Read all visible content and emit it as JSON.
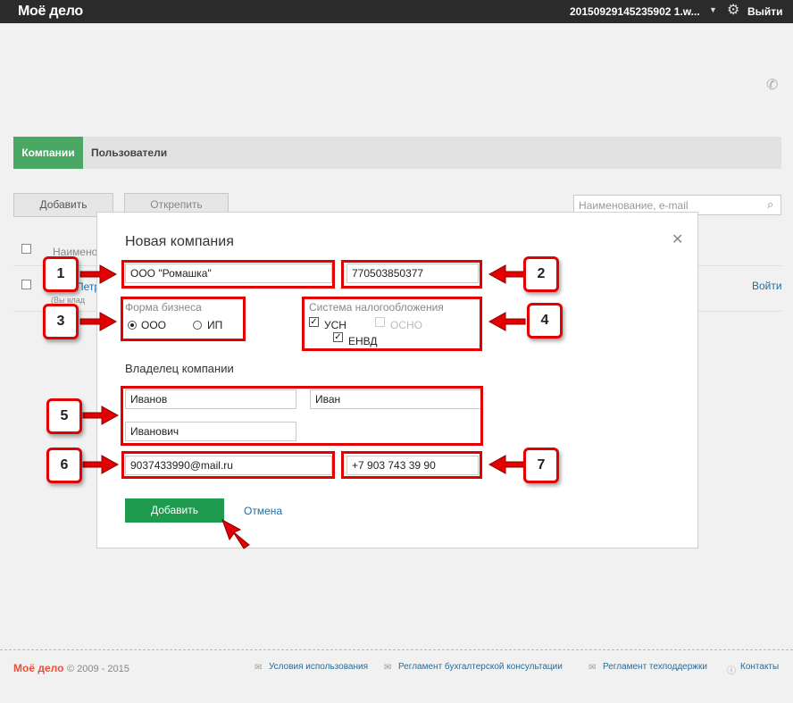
{
  "app": {
    "logo": "Моё дело",
    "account": "20150929145235902 1.w...",
    "logout": "Выйти"
  },
  "tabs": [
    {
      "label": "Компании"
    },
    {
      "label": "Пользователи"
    }
  ],
  "toolbar": {
    "add": "Добавить",
    "detach": "Открепить",
    "search_placeholder": "Наименование, e-mail"
  },
  "background": {
    "col_name": "Наимено",
    "row_text": "Петр",
    "row_sub": "(Вы влад",
    "row_login": "Войти"
  },
  "modal": {
    "title": "Новая компания",
    "company_name": "ООО \"Ромашка\"",
    "inn": "770503850377",
    "business_form": {
      "label": "Форма бизнеса",
      "options": [
        "ООО",
        "ИП"
      ],
      "selected": "ООО"
    },
    "tax_system": {
      "label": "Система налогообложения",
      "usn": "УСН",
      "osno": "ОСНО",
      "envd": "ЕНВД"
    },
    "owner_title": "Владелец компании",
    "last_name": "Иванов",
    "first_name": "Иван",
    "patronymic": "Иванович",
    "email": "9037433990@mail.ru",
    "phone": "+7 903 743 39 90",
    "submit": "Добавить",
    "cancel": "Отмена"
  },
  "callouts": [
    "1",
    "2",
    "3",
    "4",
    "5",
    "6",
    "7"
  ],
  "footer": {
    "logo": "Моё дело",
    "copyright": "© 2009 - 2015",
    "links": [
      "Условия использования",
      "Регламент бухгалтерской консультации",
      "Регламент техподдержки",
      "Контакты"
    ]
  },
  "colors": {
    "accent_green": "#1f9b4f",
    "tab_green": "#4aa865",
    "highlight_red": "#e30000",
    "link_blue": "#1d6fa5"
  }
}
